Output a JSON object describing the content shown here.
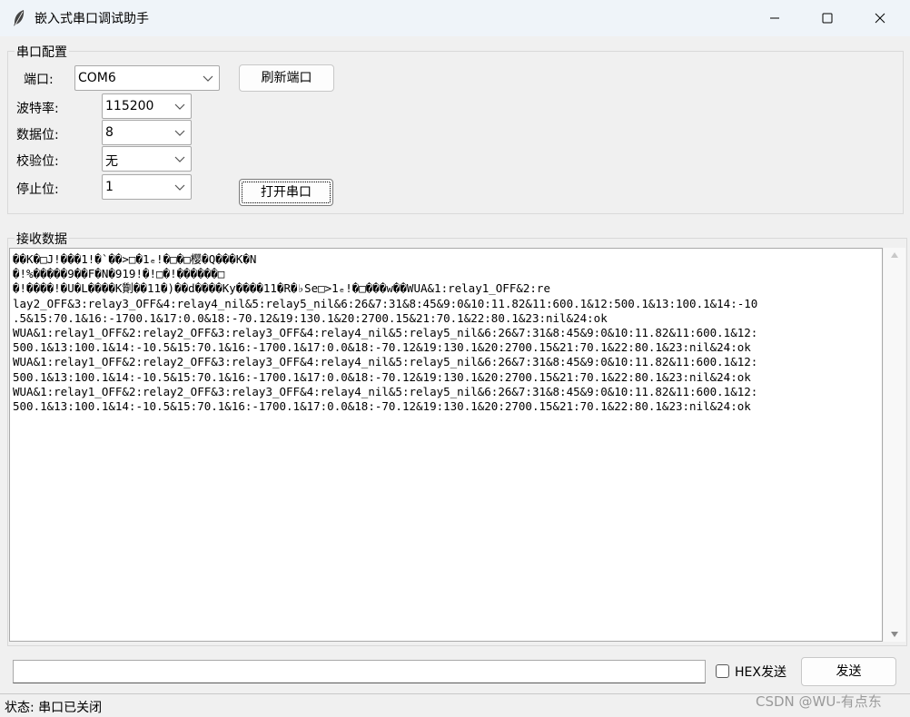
{
  "window": {
    "title": "嵌入式串口调试助手",
    "minimize_glyph": "—",
    "maximize_glyph": "☐",
    "close_glyph": "✕"
  },
  "config": {
    "group_title": "串口配置",
    "port_label": "端口:",
    "port_value": "COM6",
    "refresh_button": "刷新端口",
    "baud_label": "波特率:",
    "baud_value": "115200",
    "databits_label": "数据位:",
    "databits_value": "8",
    "parity_label": "校验位:",
    "parity_value": "无",
    "stopbits_label": "停止位:",
    "stopbits_value": "1",
    "open_button": "打开串口"
  },
  "receive": {
    "group_title": "接收数据",
    "lines": [
      "��K�□J!���1!�`��>□�1ₑ!�□�□樱�Q���K�N",
      "�!%�����9��F�N�919!�!□�!������□",
      "�!����!�U�L����K劕��11�)��d����Ky����11�R�♭Se□>1ₑ!�□���w��WUA&1:relay1_OFF&2:re",
      "lay2_OFF&3:relay3_OFF&4:relay4_nil&5:relay5_nil&6:26&7:31&8:45&9:0&10:11.82&11:600.1&12:500.1&13:100.1&14:-10",
      ".5&15:70.1&16:-1700.1&17:0.0&18:-70.12&19:130.1&20:2700.15&21:70.1&22:80.1&23:nil&24:ok",
      "WUA&1:relay1_OFF&2:relay2_OFF&3:relay3_OFF&4:relay4_nil&5:relay5_nil&6:26&7:31&8:45&9:0&10:11.82&11:600.1&12:",
      "500.1&13:100.1&14:-10.5&15:70.1&16:-1700.1&17:0.0&18:-70.12&19:130.1&20:2700.15&21:70.1&22:80.1&23:nil&24:ok",
      "WUA&1:relay1_OFF&2:relay2_OFF&3:relay3_OFF&4:relay4_nil&5:relay5_nil&6:26&7:31&8:45&9:0&10:11.82&11:600.1&12:",
      "500.1&13:100.1&14:-10.5&15:70.1&16:-1700.1&17:0.0&18:-70.12&19:130.1&20:2700.15&21:70.1&22:80.1&23:nil&24:ok",
      "WUA&1:relay1_OFF&2:relay2_OFF&3:relay3_OFF&4:relay4_nil&5:relay5_nil&6:26&7:31&8:45&9:0&10:11.82&11:600.1&12:",
      "500.1&13:100.1&14:-10.5&15:70.1&16:-1700.1&17:0.0&18:-70.12&19:130.1&20:2700.15&21:70.1&22:80.1&23:nil&24:ok"
    ]
  },
  "send": {
    "input_value": "",
    "hex_label": "HEX发送",
    "send_button": "发送"
  },
  "status": {
    "text": "状态: 串口已关闭"
  },
  "watermark": "CSDN @WU-有点东"
}
